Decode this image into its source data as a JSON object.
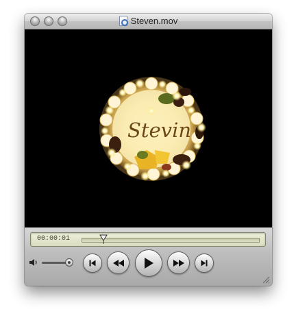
{
  "window": {
    "title": "Steven.mov",
    "title_icon": "quicktime-movie-icon",
    "buttons": [
      "close",
      "minimize",
      "zoom"
    ]
  },
  "video": {
    "content": "birthday cake with candles",
    "cake_text": "Stevin"
  },
  "player": {
    "timecode": "00:00:01",
    "progress": 0.12,
    "volume": 1.0,
    "controls": [
      "go-to-start",
      "rewind",
      "play",
      "fast-forward",
      "go-to-end"
    ]
  },
  "colors": {
    "lcd_background": "#e3e6cb",
    "window_chrome": "#bdbdbd"
  }
}
